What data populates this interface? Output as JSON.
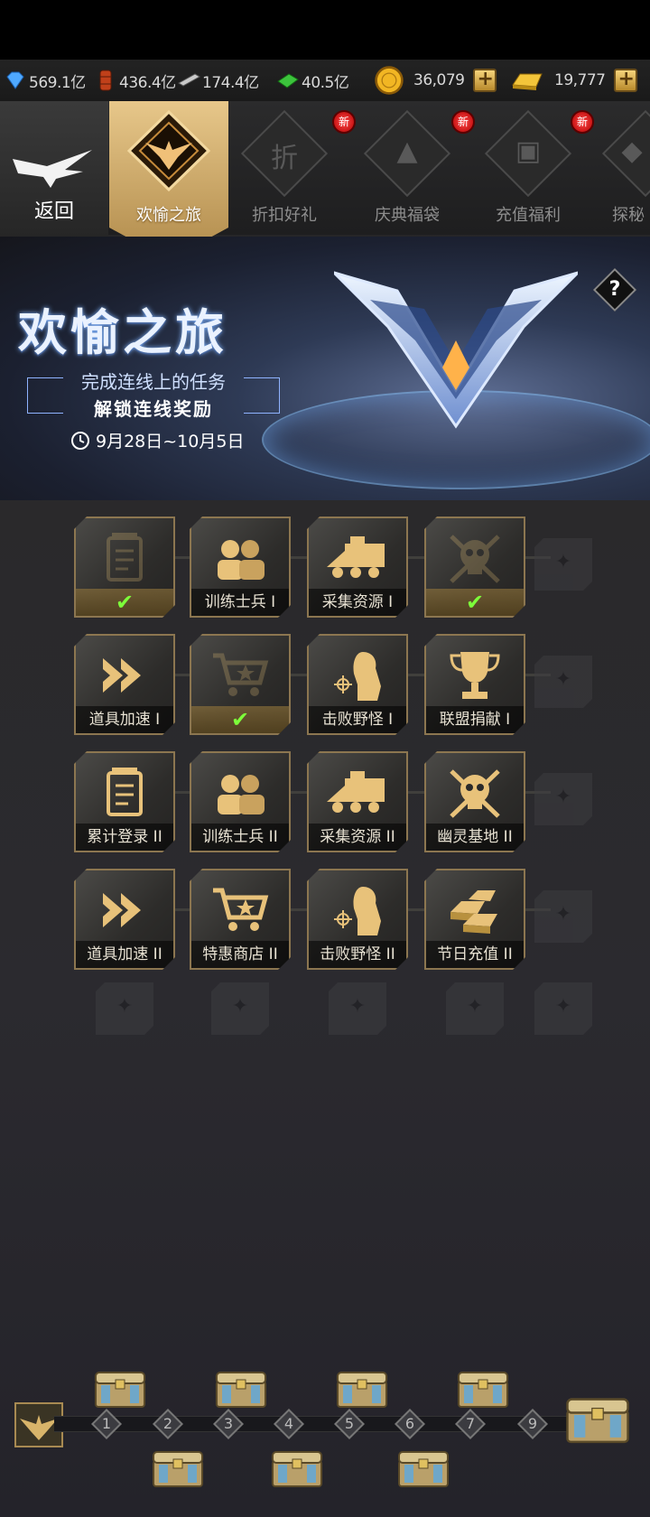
{
  "resources": [
    {
      "name": "diamond-icon",
      "value": "569.1亿"
    },
    {
      "name": "oil-barrel-icon",
      "value": "436.4亿"
    },
    {
      "name": "steel-icon",
      "value": "174.4亿"
    },
    {
      "name": "cash-icon",
      "value": "40.5亿"
    },
    {
      "name": "coin-icon",
      "value": "36,079"
    },
    {
      "name": "gold-bar-icon",
      "value": "19,777"
    }
  ],
  "plus_label": "+",
  "tabs": {
    "back": "返回",
    "active": "欢愉之旅",
    "others": [
      {
        "label": "折扣好礼",
        "icon_text": "折",
        "badge": "新"
      },
      {
        "label": "庆典福袋",
        "icon_text": "▲",
        "badge": "新"
      },
      {
        "label": "充值福利",
        "icon_text": "▣",
        "badge": "新"
      },
      {
        "label": "探秘",
        "icon_text": "◆",
        "badge": ""
      }
    ]
  },
  "banner": {
    "title": "欢愉之旅",
    "subtitle1": "完成连线上的任务",
    "subtitle2": "解锁连线奖励",
    "date": "9月28日~10月5日",
    "help": "?"
  },
  "tiles": [
    {
      "label": "",
      "icon": "notepad-icon",
      "done": true,
      "check": "✔"
    },
    {
      "label": "训练士兵 I",
      "icon": "soldiers-icon",
      "done": false
    },
    {
      "label": "采集资源 I",
      "icon": "truck-icon",
      "done": false
    },
    {
      "label": "",
      "icon": "skull-icon",
      "done": true,
      "check": "✔"
    },
    {
      "label": "道具加速 I",
      "icon": "speed-arrows-icon",
      "done": false
    },
    {
      "label": "",
      "icon": "cart-icon",
      "done": true,
      "check": "✔"
    },
    {
      "label": "击败野怪 I",
      "icon": "monster-icon",
      "done": false
    },
    {
      "label": "联盟捐献 I",
      "icon": "trophy-icon",
      "done": false
    },
    {
      "label": "累计登录 II",
      "icon": "notepad-icon",
      "done": false
    },
    {
      "label": "训练士兵 II",
      "icon": "soldiers-icon",
      "done": false
    },
    {
      "label": "采集资源 II",
      "icon": "truck-icon",
      "done": false
    },
    {
      "label": "幽灵基地 II",
      "icon": "skull-icon",
      "done": false
    },
    {
      "label": "道具加速 II",
      "icon": "speed-arrows-icon",
      "done": false
    },
    {
      "label": "特惠商店 II",
      "icon": "cart-icon",
      "done": false
    },
    {
      "label": "击败野怪 II",
      "icon": "monster-icon",
      "done": false
    },
    {
      "label": "节日充值 II",
      "icon": "gold-bars-icon",
      "done": false
    }
  ],
  "track_nodes": [
    "1",
    "2",
    "3",
    "4",
    "5",
    "6",
    "7",
    "9"
  ],
  "colors": {
    "accent_gold": "#e7c78a",
    "check_green": "#7dff3a",
    "badge_red": "#e02020"
  }
}
